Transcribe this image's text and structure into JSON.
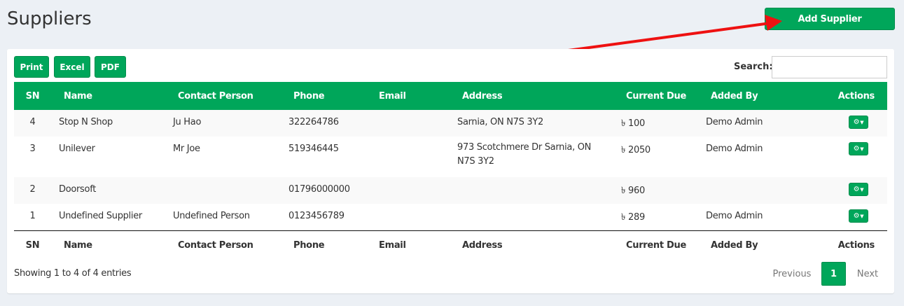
{
  "page": {
    "title": "Suppliers"
  },
  "toolbar": {
    "add_label": "Add Supplier",
    "export_buttons": [
      "Print",
      "Excel",
      "PDF"
    ],
    "search_label": "Search:",
    "search_value": ""
  },
  "table": {
    "columns": [
      "SN",
      "Name",
      "Contact Person",
      "Phone",
      "Email",
      "Address",
      "Current Due",
      "Added By",
      "Actions"
    ],
    "rows": [
      {
        "sn": "4",
        "name": "Stop N Shop",
        "contact": "Ju Hao",
        "phone": "322264786",
        "email": "",
        "address": "Sarnia, ON N7S 3Y2",
        "due": "৳ 100",
        "added_by": "Demo Admin"
      },
      {
        "sn": "3",
        "name": "Unilever",
        "contact": "Mr Joe",
        "phone": "519346445",
        "email": "",
        "address": "973 Scotchmere Dr Sarnia, ON N7S 3Y2",
        "due": "৳ 2050",
        "added_by": "Demo Admin"
      },
      {
        "sn": "2",
        "name": "Doorsoft",
        "contact": "",
        "phone": "01796000000",
        "email": "",
        "address": "",
        "due": "৳ 960",
        "added_by": ""
      },
      {
        "sn": "1",
        "name": "Undefined Supplier",
        "contact": "Undefined Person",
        "phone": "0123456789",
        "email": "",
        "address": "",
        "due": "৳ 289",
        "added_by": "Demo Admin"
      }
    ]
  },
  "footer": {
    "info": "Showing 1 to 4 of 4 entries",
    "prev_label": "Previous",
    "current_page": "1",
    "next_label": "Next"
  },
  "colors": {
    "accent": "#00a65a",
    "arrow": "#ee1111"
  },
  "icons": {
    "action": "gear-icon",
    "action_caret": "caret-down-icon"
  }
}
